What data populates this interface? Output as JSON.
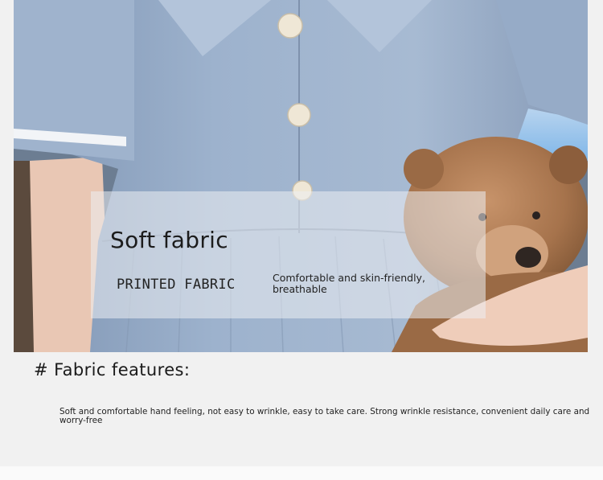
{
  "overlay": {
    "title": "Soft fabric",
    "tag": "PRINTED FABRIC",
    "description": "Comfortable and skin-friendly, breathable"
  },
  "section": {
    "heading": "# Fabric features:",
    "body": "Soft and comfortable hand feeling, not easy to wrinkle, easy to take care. Strong wrinkle resistance, convenient daily care and worry-free"
  },
  "colors": {
    "dress": "#8fa6c4",
    "bear": "#9c6a45",
    "page_background": "#f1f1f1"
  }
}
